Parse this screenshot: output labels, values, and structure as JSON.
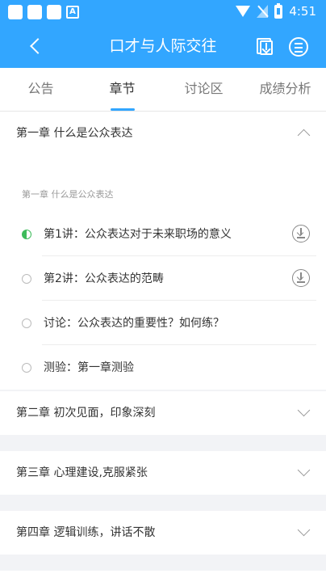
{
  "status_bar": {
    "time": "4:51",
    "icons": [
      "app-icon",
      "app-icon",
      "app-icon",
      "a-icon",
      "wifi-icon",
      "no-signal-icon",
      "battery-icon"
    ]
  },
  "app_bar": {
    "title": "口才与人际交往",
    "icons": [
      "back-icon",
      "download-list-icon",
      "menu-icon"
    ]
  },
  "tabs": [
    {
      "label": "公告",
      "active": false
    },
    {
      "label": "章节",
      "active": true
    },
    {
      "label": "讨论区",
      "active": false
    },
    {
      "label": "成绩分析",
      "active": false
    }
  ],
  "chapters": [
    {
      "title": "第一章 什么是公众表达",
      "expanded": true,
      "subtitle": "第一章 什么是公众表达",
      "lessons": [
        {
          "label": "第1讲：公众表达对于未来职场的意义",
          "status": "in-progress",
          "downloadable": true
        },
        {
          "label": "第2讲：公众表达的范畴",
          "status": "not-started",
          "downloadable": true
        },
        {
          "label": "讨论：公众表达的重要性？如何练？",
          "status": "not-started",
          "downloadable": false
        },
        {
          "label": "测验：第一章测验",
          "status": "not-started",
          "downloadable": false
        }
      ]
    },
    {
      "title": "第二章 初次见面，印象深刻",
      "expanded": false
    },
    {
      "title": "第三章 心理建设,克服紧张",
      "expanded": false
    },
    {
      "title": "第四章 逻辑训练，讲话不散",
      "expanded": false
    }
  ],
  "colors": {
    "primary": "#32a6ff",
    "progress": "#3dbb5a"
  }
}
